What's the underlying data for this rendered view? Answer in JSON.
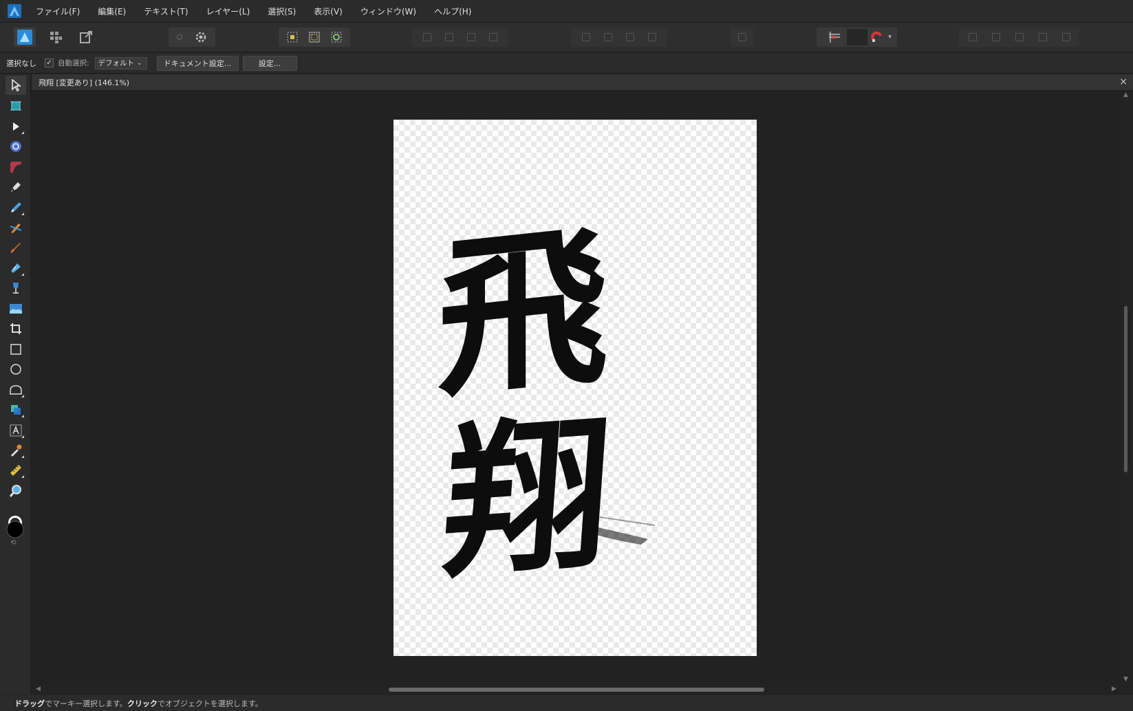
{
  "menu": {
    "items": [
      "ファイル(F)",
      "編集(E)",
      "テキスト(T)",
      "レイヤー(L)",
      "選択(S)",
      "表示(V)",
      "ウィンドウ(W)",
      "ヘルプ(H)"
    ]
  },
  "context": {
    "selection_status": "選択なし",
    "auto_select_label": "自動選択:",
    "auto_select_checked": "✓",
    "auto_select_value": "デフォルト",
    "doc_setup_button": "ドキュメント設定...",
    "settings_button": "設定..."
  },
  "document": {
    "tab_title": "飛翔 [変更あり] (146.1%)",
    "close_symbol": "×",
    "artwork_text": "飛翔"
  },
  "status": {
    "drag_word": "ドラッグ",
    "part1": "でマーキー選択します。",
    "click_word": "クリック",
    "part2": "でオブジェクトを選択します。"
  },
  "colors": {
    "accent": "#2a8cd7",
    "ink": "#0d0d0d",
    "background": "#232323"
  },
  "icons": {
    "tools": [
      "move-tool-icon",
      "artboard-tool-icon",
      "node-tool-icon",
      "corner-tool-icon",
      "point-transform-icon",
      "pen-tool-icon",
      "pencil-tool-icon",
      "vector-brush-icon",
      "paint-brush-icon",
      "fill-tool-icon",
      "transparency-tool-icon",
      "place-image-icon",
      "crop-tool-icon",
      "rectangle-tool-icon",
      "ellipse-tool-icon",
      "rounded-shape-icon",
      "shape-tool-icon",
      "artistic-text-icon",
      "color-picker-icon",
      "measure-tool-icon",
      "zoom-tool-icon"
    ]
  }
}
